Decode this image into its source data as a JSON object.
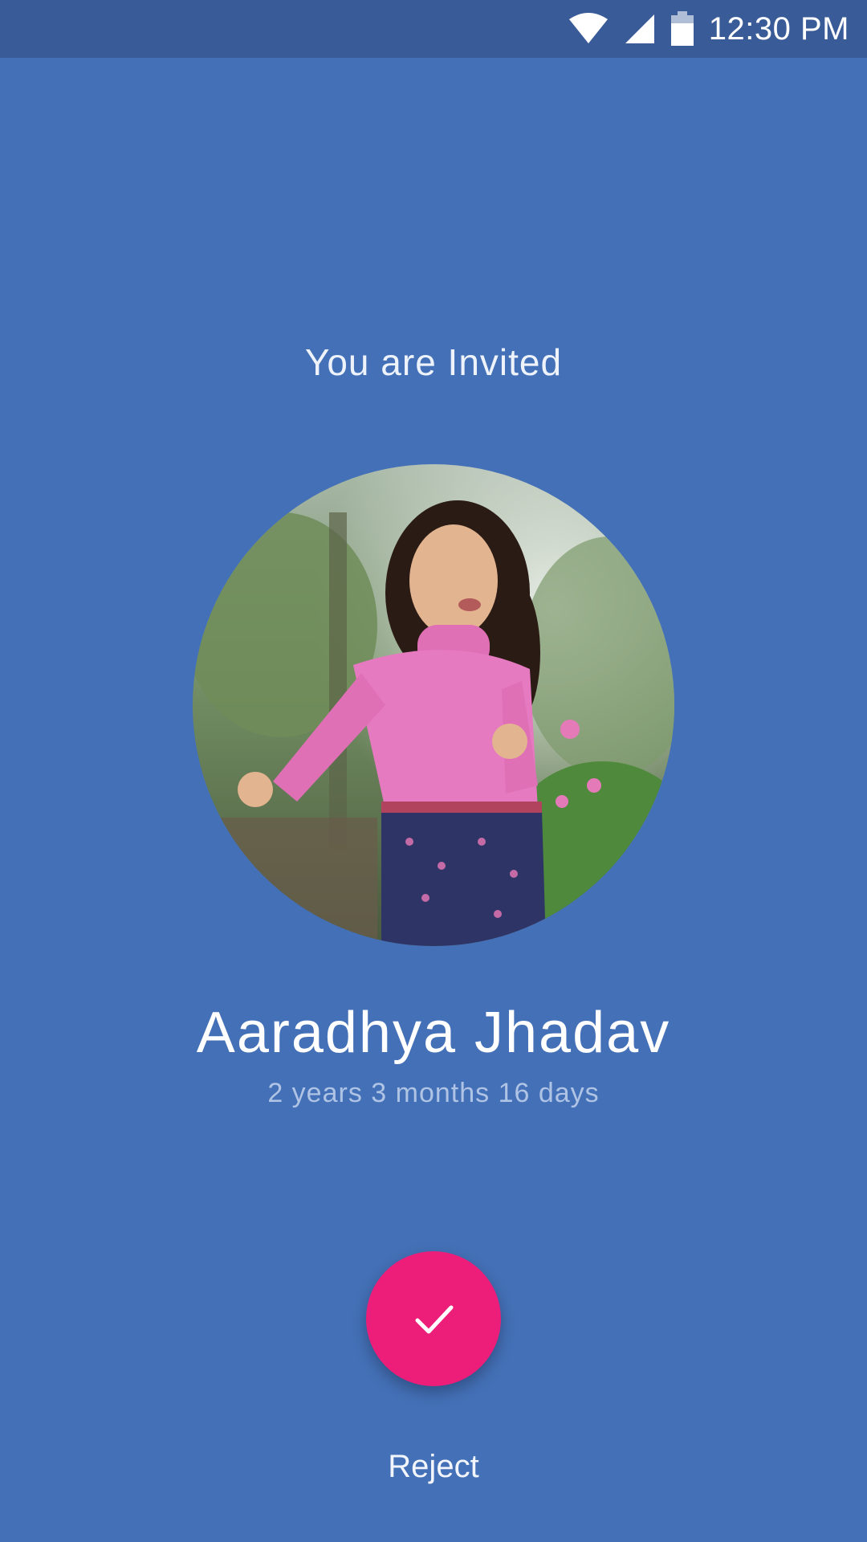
{
  "status_bar": {
    "time": "12:30 PM",
    "icons": [
      "wifi-icon",
      "cell-signal-icon",
      "battery-icon"
    ]
  },
  "invite": {
    "title": "You are Invited",
    "avatar_icon": "child-photo",
    "name": "Aaradhya Jhadav",
    "age": "2 years 3 months 16 days",
    "accept_icon": "check-icon",
    "reject_label": "Reject"
  },
  "colors": {
    "background": "#4470B7",
    "status_bar": "#395C98",
    "accent": "#EC1E79"
  }
}
